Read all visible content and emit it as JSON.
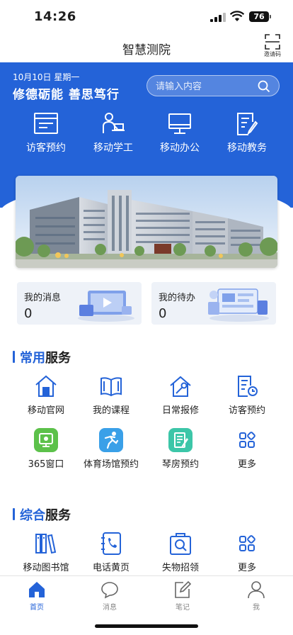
{
  "status_bar": {
    "time": "14:26",
    "battery": "76"
  },
  "navbar": {
    "title": "智慧测院",
    "invite_label": "邀请码"
  },
  "header": {
    "date": "10月10日  星期一",
    "slogan": "修德砺能  善思笃行",
    "search_placeholder": "请输入内容",
    "quick_links": [
      {
        "label": "访客预约",
        "icon": "visitor-form-icon"
      },
      {
        "label": "移动学工",
        "icon": "student-desk-icon"
      },
      {
        "label": "移动办公",
        "icon": "monitor-icon"
      },
      {
        "label": "移动教务",
        "icon": "edit-document-icon"
      }
    ]
  },
  "cards": [
    {
      "title": "我的消息",
      "count": "0"
    },
    {
      "title": "我的待办",
      "count": "0"
    }
  ],
  "common_services": {
    "title_highlight": "常用",
    "title_rest": "服务",
    "items": [
      {
        "label": "移动官网",
        "icon": "home-icon"
      },
      {
        "label": "我的课程",
        "icon": "book-icon"
      },
      {
        "label": "日常报修",
        "icon": "repair-house-icon"
      },
      {
        "label": "访客预约",
        "icon": "visitor-schedule-icon"
      },
      {
        "label": "365窗口",
        "icon": "window-365-icon"
      },
      {
        "label": "体育场馆预约",
        "icon": "sports-icon"
      },
      {
        "label": "琴房预约",
        "icon": "piano-room-icon"
      },
      {
        "label": "更多",
        "icon": "more-grid-icon"
      }
    ]
  },
  "general_services": {
    "title_highlight": "综合",
    "title_rest": "服务",
    "items": [
      {
        "label": "移动图书馆",
        "icon": "library-icon"
      },
      {
        "label": "电话黄页",
        "icon": "phonebook-icon"
      },
      {
        "label": "失物招领",
        "icon": "lost-found-icon"
      },
      {
        "label": "更多",
        "icon": "more-grid-icon"
      }
    ]
  },
  "tabbar": [
    {
      "label": "首页",
      "active": true
    },
    {
      "label": "消息",
      "active": false
    },
    {
      "label": "笔记",
      "active": false
    },
    {
      "label": "我",
      "active": false
    }
  ],
  "colors": {
    "primary": "#2463d8",
    "green": "#5cc14a",
    "sky": "#3aa0e8",
    "teal": "#3cc6a8"
  }
}
